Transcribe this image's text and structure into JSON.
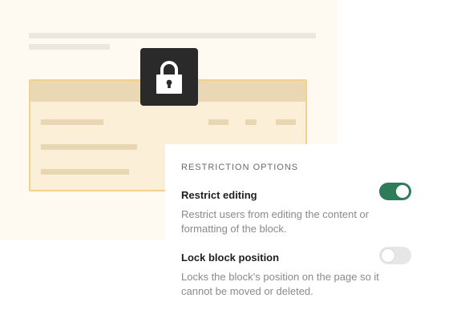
{
  "restriction_options": {
    "section_title": "RESTRICTION OPTIONS",
    "options": [
      {
        "title": "Restrict editing",
        "description": "Restrict users from editing the content or formatting of the block.",
        "enabled": true
      },
      {
        "title": "Lock block position",
        "description": "Locks the block’s position on the page so it cannot be moved or deleted.",
        "enabled": false
      }
    ]
  },
  "icons": {
    "lock": "lock-icon"
  },
  "colors": {
    "toggle_on": "#2f7c5a",
    "toggle_off": "#e6e6e6",
    "lock_tile": "#2a2a2a",
    "table_border": "#f0d18f",
    "background_panel": "#fefaf2"
  }
}
